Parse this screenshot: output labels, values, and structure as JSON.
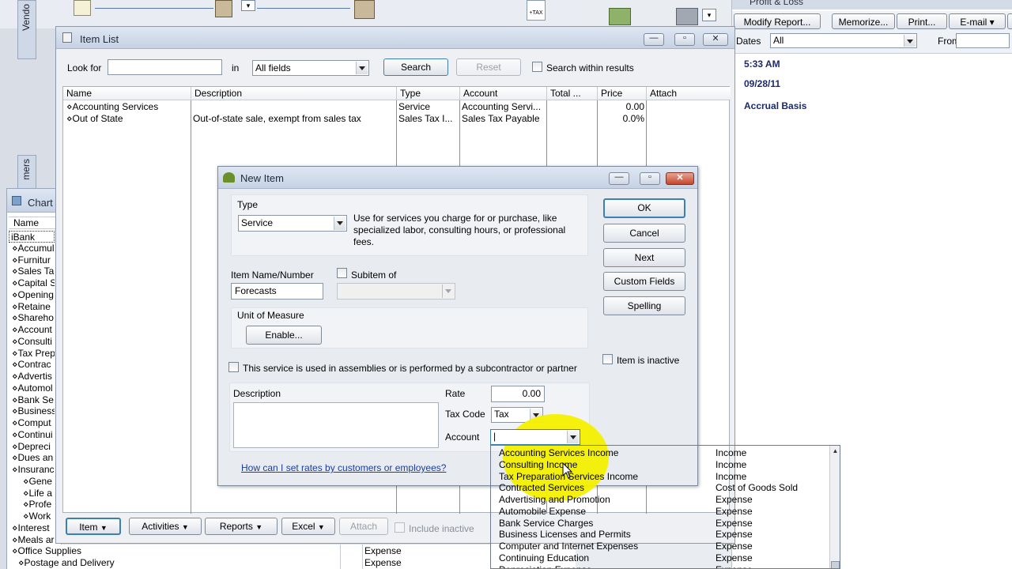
{
  "background": {
    "vendor_tab": "Vendo",
    "customers_tab": "mers"
  },
  "report": {
    "title": "Profit & Loss",
    "buttons": [
      "Modify Report...",
      "Memorize...",
      "Print...",
      "E-mail ▾",
      "Ex"
    ],
    "dates_label": "Dates",
    "dates_value": "All",
    "from_label": "From",
    "time": "5:33 AM",
    "date": "09/28/11",
    "basis": "Accrual Basis"
  },
  "chart_window": {
    "title": "Chart",
    "col_name": "Name",
    "rows": [
      "iBank",
      "⋄Accumul",
      "⋄Furnitur",
      "⋄Sales Ta",
      "⋄Capital S",
      "⋄Opening",
      "⋄Retaine",
      "⋄Shareho",
      "⋄Account",
      "⋄Consulti",
      "⋄Tax Prep",
      "⋄Contrac",
      "⋄Advertis",
      "⋄Automol",
      "⋄Bank Se",
      "⋄Business",
      "⋄Comput",
      "⋄Continui",
      "⋄Depreci",
      "⋄Dues an",
      "⋄Insuranc",
      "⋄Gene",
      "⋄Life a",
      "⋄Profe",
      "⋄Work",
      "⋄Interest",
      "⋄Meals ar"
    ],
    "bottom_rows": [
      {
        "name": "⋄Office Supplies",
        "type": "Expense"
      },
      {
        "name": "⋄Postage and Delivery",
        "type": "Expense"
      }
    ]
  },
  "item_list": {
    "title": "Item List",
    "look_for_label": "Look for",
    "look_for_value": "",
    "in_label": "in",
    "in_value": "All fields",
    "search_label": "Search",
    "reset_label": "Reset",
    "search_within_label": "Search within results",
    "columns": [
      "Name",
      "Description",
      "Type",
      "Account",
      "Total ...",
      "Price",
      "Attach"
    ],
    "rows": [
      {
        "name": "⋄Accounting Services",
        "description": "",
        "type": "Service",
        "account": "Accounting Servi...",
        "price": "0.00"
      },
      {
        "name": "⋄Out of State",
        "description": "Out-of-state sale, exempt from sales tax",
        "type": "Sales Tax I...",
        "account": "Sales Tax Payable",
        "price": "0.0%"
      }
    ],
    "footer": {
      "item": "Item",
      "activities": "Activities",
      "reports": "Reports",
      "excel": "Excel",
      "attach": "Attach",
      "include_inactive": "Include inactive"
    }
  },
  "new_item": {
    "title": "New Item",
    "type_label": "Type",
    "type_value": "Service",
    "type_help": "Use for services you charge for or purchase, like specialized labor, consulting hours, or professional fees.",
    "item_name_label": "Item Name/Number",
    "item_name_value": "Forecasts",
    "subitem_label": "Subitem of",
    "subitem_value": "",
    "uom_label": "Unit of Measure",
    "enable_label": "Enable...",
    "assemblies_label": "This service is used in assemblies or is performed by a subcontractor or partner",
    "description_label": "Description",
    "rate_label": "Rate",
    "rate_value": "0.00",
    "tax_code_label": "Tax Code",
    "tax_code_value": "Tax",
    "account_label": "Account",
    "account_value": "|",
    "help_link": "How can I set rates by customers or employees?",
    "ok_label": "OK",
    "cancel_label": "Cancel",
    "next_label": "Next",
    "custom_fields_label": "Custom Fields",
    "spelling_label": "Spelling",
    "inactive_label": "Item is inactive"
  },
  "account_dropdown": {
    "rows": [
      {
        "name": "Accounting Services Income",
        "type": "Income"
      },
      {
        "name": "Consulting Income",
        "type": "Income"
      },
      {
        "name": "Tax Preparation Services Income",
        "type": "Income"
      },
      {
        "name": "Contracted Services",
        "type": "Cost of Goods Sold"
      },
      {
        "name": "Advertising and Promotion",
        "type": "Expense"
      },
      {
        "name": "Automobile Expense",
        "type": "Expense"
      },
      {
        "name": "Bank Service Charges",
        "type": "Expense"
      },
      {
        "name": "Business Licenses and Permits",
        "type": "Expense"
      },
      {
        "name": "Computer and Internet Expenses",
        "type": "Expense"
      },
      {
        "name": "Continuing Education",
        "type": "Expense"
      },
      {
        "name": "Depreciation Expense",
        "type": "Expense"
      }
    ]
  },
  "colors": {
    "highlight": "#f4f000",
    "title_gradient_top": "#dee6f2",
    "link": "#1a3ea0",
    "report_text": "#1c2a6b",
    "close_button": "#c4462c"
  }
}
